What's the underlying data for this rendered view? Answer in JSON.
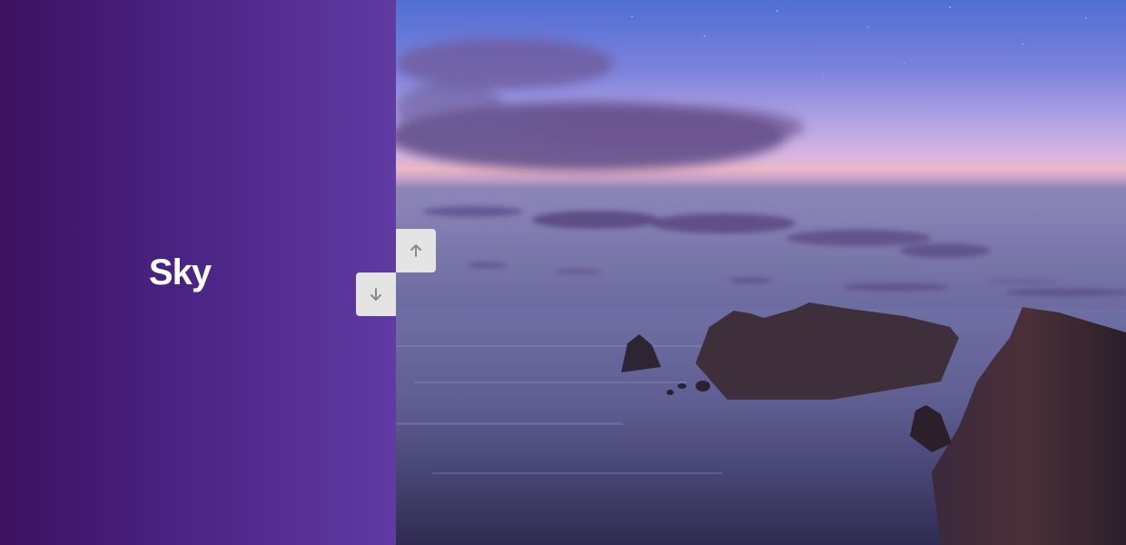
{
  "left_slide": {
    "title": "Sky",
    "background_colors": [
      "#3c1160",
      "#5f3ba2"
    ]
  },
  "right_slide": {
    "image_alt": "coastline-at-dusk-image"
  },
  "controls": {
    "up_icon": "arrow-up-icon",
    "down_icon": "arrow-down-icon",
    "button_color": "#e4e4e4",
    "icon_color": "#8a8a8a"
  }
}
